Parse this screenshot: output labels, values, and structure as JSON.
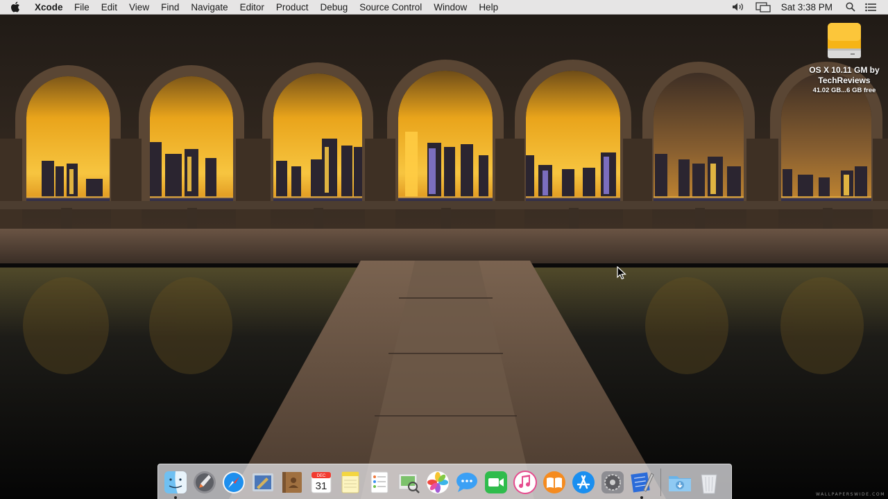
{
  "menubar": {
    "app_name": "Xcode",
    "menus": [
      "File",
      "Edit",
      "View",
      "Find",
      "Navigate",
      "Editor",
      "Product",
      "Debug",
      "Source Control",
      "Window",
      "Help"
    ],
    "clock": "Sat 3:38 PM",
    "status_icons": [
      "volume-icon",
      "display-mirroring-icon",
      "spotlight-search-icon",
      "notification-center-icon"
    ]
  },
  "desktop": {
    "drive": {
      "name_line1": "OS X 10.11 GM by",
      "name_line2": "TechReviews",
      "info": "41.02 GB...6 GB free"
    },
    "wallpaper_watermark": "WALLPAPERSWIDE.COM"
  },
  "dock": {
    "apps": [
      {
        "name": "Finder",
        "icon": "finder-icon",
        "running": true
      },
      {
        "name": "Launchpad",
        "icon": "launchpad-icon",
        "running": false
      },
      {
        "name": "Safari",
        "icon": "safari-icon",
        "running": false
      },
      {
        "name": "Mail",
        "icon": "mail-icon",
        "running": false
      },
      {
        "name": "Contacts",
        "icon": "contacts-icon",
        "running": false
      },
      {
        "name": "Calendar",
        "icon": "calendar-icon",
        "running": false,
        "month": "DEC",
        "day": "31"
      },
      {
        "name": "Notes",
        "icon": "notes-icon",
        "running": false
      },
      {
        "name": "Reminders",
        "icon": "reminders-icon",
        "running": false
      },
      {
        "name": "Preview",
        "icon": "preview-icon",
        "running": false
      },
      {
        "name": "Photos",
        "icon": "photos-icon",
        "running": false
      },
      {
        "name": "Messages",
        "icon": "messages-icon",
        "running": false
      },
      {
        "name": "FaceTime",
        "icon": "facetime-icon",
        "running": false
      },
      {
        "name": "iTunes",
        "icon": "itunes-icon",
        "running": false
      },
      {
        "name": "iBooks",
        "icon": "ibooks-icon",
        "running": false
      },
      {
        "name": "App Store",
        "icon": "app-store-icon",
        "running": false
      },
      {
        "name": "System Preferences",
        "icon": "system-preferences-icon",
        "running": false
      },
      {
        "name": "Xcode",
        "icon": "xcode-icon",
        "running": true
      }
    ],
    "stack_items": [
      {
        "name": "Downloads",
        "icon": "downloads-folder-icon"
      },
      {
        "name": "Trash",
        "icon": "trash-icon"
      }
    ]
  },
  "colors": {
    "menubar_bg": "#ececec",
    "sky_top": "#2a2420",
    "sky_gold": "#f4b21c",
    "arch_stone": "#4a3a2c",
    "water": "#0d0f12"
  }
}
